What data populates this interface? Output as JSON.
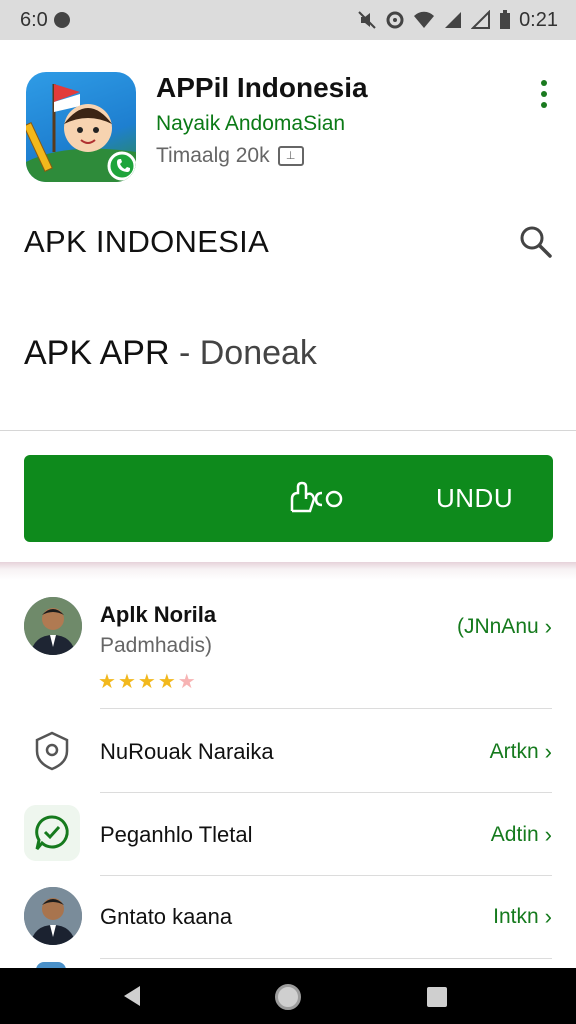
{
  "status_bar": {
    "time_left": "6:0",
    "time_right": "0:21"
  },
  "app": {
    "title": "APPil Indonesia",
    "developer": "Nayaik AndomaSian",
    "meta": "Timaalg 20k"
  },
  "search": {
    "title": "APK INDONESIA"
  },
  "subtitle": {
    "main": "APK APR",
    "rest": " - Doneak"
  },
  "download": {
    "label": "UNDU"
  },
  "list": [
    {
      "title": "Aplk Norila",
      "subtitle": "Padmhadis)",
      "action": "(JNnAnu",
      "rating": 4,
      "icon": "person-avatar"
    },
    {
      "title": "NuRouak Naraika",
      "action": "Artkn",
      "icon": "location-shield-icon"
    },
    {
      "title": "Peganhlo Tletal",
      "action": "Adtin",
      "icon": "chat-check-icon"
    },
    {
      "title": "Gntato kaana",
      "action": "Intkn",
      "icon": "person-avatar"
    }
  ],
  "colors": {
    "accent_green": "#0e8a1c",
    "link_green": "#157a1d",
    "star": "#f2b81c"
  }
}
